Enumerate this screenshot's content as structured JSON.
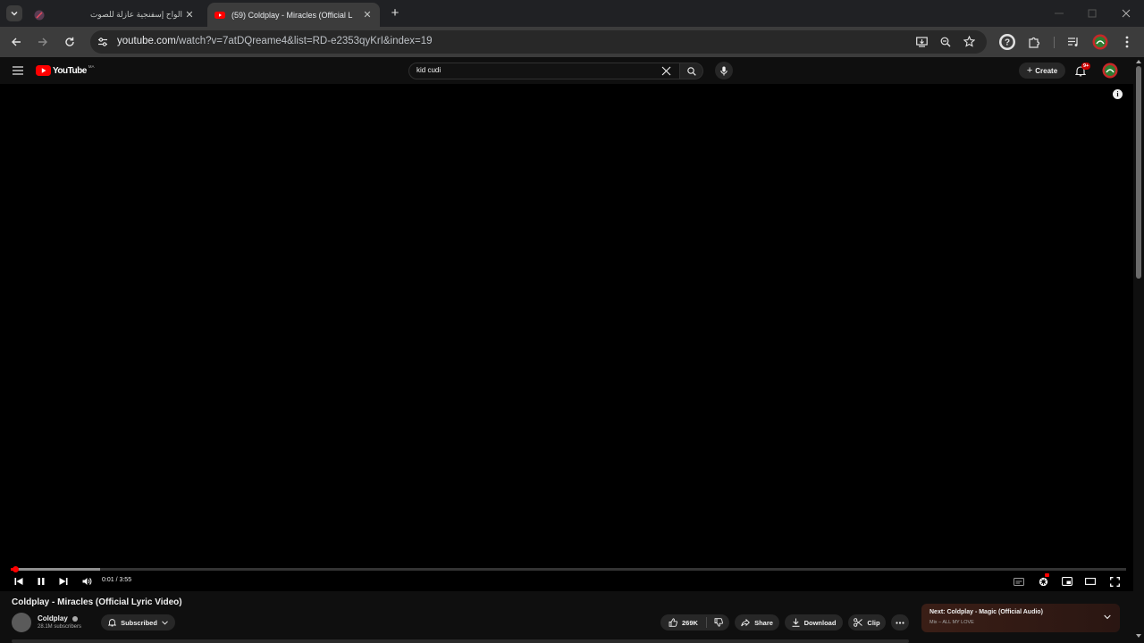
{
  "browser": {
    "tabs": [
      {
        "title": "الواح إسفنجية عازلة للصوت",
        "active": false
      },
      {
        "title": "(59) Coldplay - Miracles (Official L",
        "active": true
      }
    ],
    "url_host": "youtube.com",
    "url_path": "/watch?v=7atDQreame4&list=RD-e2353qyKrI&index=19"
  },
  "youtube": {
    "logo_text": "YouTube",
    "country_code": "MA",
    "search_value": "kid cudi",
    "create_label": "Create",
    "notifications_badge": "9+",
    "brand_color": "#ff0000"
  },
  "player": {
    "time_display": "0:01 / 3:55",
    "progress_fraction": 0.004,
    "buffered_fraction": 0.08
  },
  "video": {
    "title": "Coldplay - Miracles (Official Lyric Video)",
    "channel": "Coldplay",
    "subscribers": "28.1M subscribers",
    "subscribed_label": "Subscribed",
    "likes": "269K",
    "share_label": "Share",
    "download_label": "Download",
    "clip_label": "Clip"
  },
  "up_next": {
    "title": "Next: Coldplay - Magic (Official Audio)",
    "subtitle": "Mix – ALL MY LOVE"
  }
}
